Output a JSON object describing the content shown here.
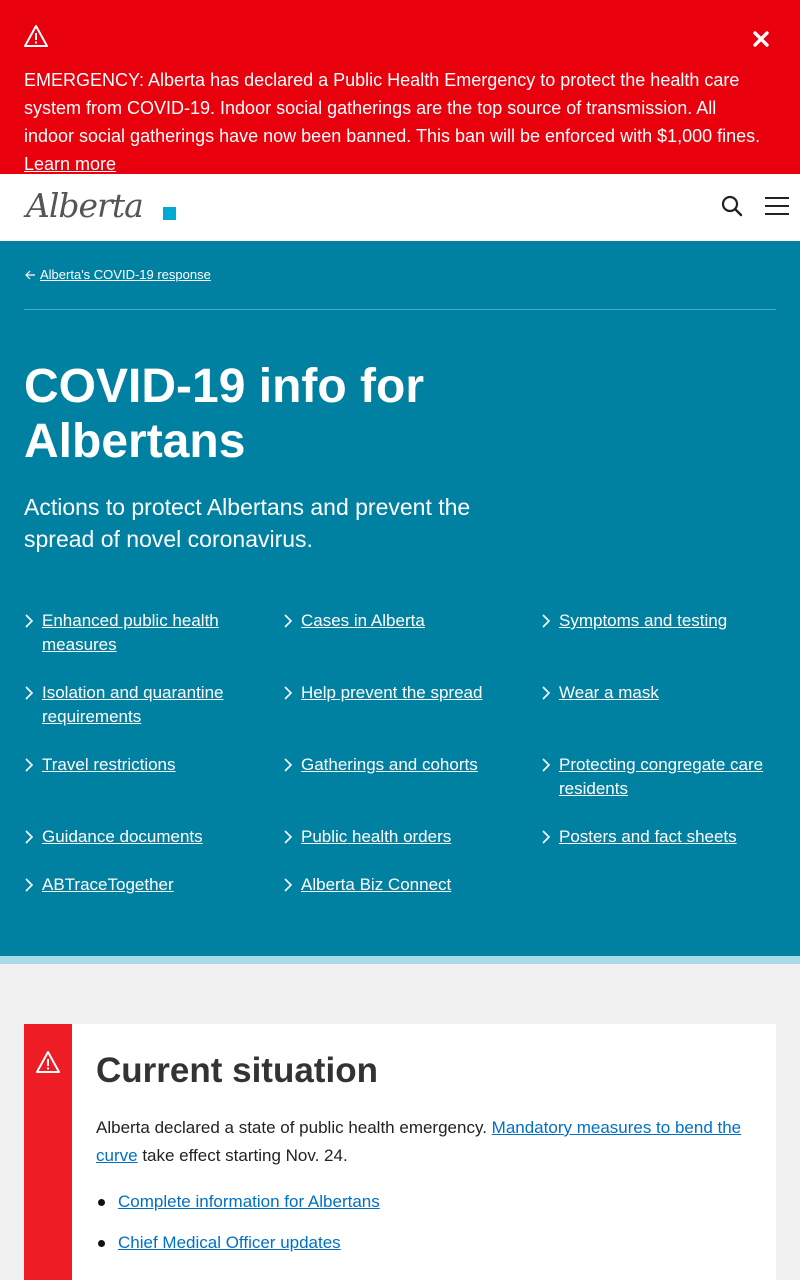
{
  "alert": {
    "icon": "warning-triangle-icon",
    "message": "EMERGENCY: Alberta has declared a Public Health Emergency to protect the health care system from COVID-19. Indoor social gatherings are the top source of transmission. All indoor social gatherings have now been banned. This ban will be enforced with $1,000 fines.",
    "link_label": "Learn more",
    "close_icon": "close-icon",
    "background": "#e8000d"
  },
  "header": {
    "logo_text": "Alberta",
    "search_icon": "search-icon",
    "menu_icon": "hamburger-menu-icon"
  },
  "hero": {
    "background": "#0081a2",
    "breadcrumb": "Alberta's COVID-19 response",
    "title": "COVID-19 info for Albertans",
    "subtitle": "Actions to protect Albertans and prevent the spread of novel coronavirus.",
    "links": [
      "Enhanced public health measures",
      "Cases in Alberta",
      "Symptoms and testing",
      "Isolation and quarantine requirements",
      "Help prevent the spread",
      "Wear a mask",
      "Travel restrictions",
      "Gatherings and cohorts",
      "Protecting congregate care residents",
      "Guidance documents",
      "Public health orders",
      "Posters and fact sheets",
      "ABTraceTogether",
      "Alberta Biz Connect"
    ]
  },
  "situation": {
    "title": "Current situation",
    "text_before": "Alberta declared a state of public health emergency.",
    "link": "Mandatory measures to bend the curve",
    "text_after": "take effect starting Nov. 24.",
    "list": [
      "Complete information for Albertans",
      "Chief Medical Officer updates"
    ],
    "accent": "#ee1c25"
  }
}
